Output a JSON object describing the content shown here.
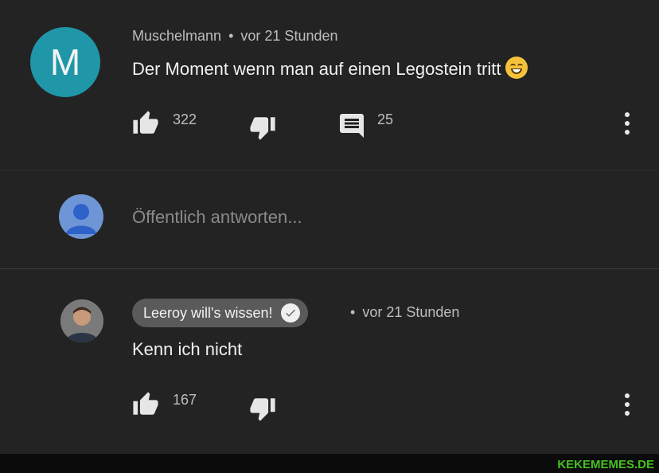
{
  "comment": {
    "avatar_letter": "M",
    "author": "Muschelmann",
    "separator": "•",
    "time": "vor 21 Stunden",
    "text": "Der Moment wenn man auf einen Legostein tritt",
    "likes": "322",
    "replies": "25"
  },
  "reply_box": {
    "placeholder": "Öffentlich antworten..."
  },
  "reply": {
    "author": "Leeroy will's wissen!",
    "separator": "•",
    "time": "vor 21 Stunden",
    "text": "Kenn ich nicht",
    "likes": "167"
  },
  "watermark": "KEKEMEMES.DE",
  "colors": {
    "background": "#232323",
    "avatar_teal": "#1f97a8",
    "default_avatar_blue": "#6e95d6",
    "watermark_green": "#43c21f"
  },
  "icons": [
    "thumb-up-icon",
    "thumb-down-icon",
    "comment-icon",
    "more-vert-icon",
    "verified-check-icon",
    "default-user-icon"
  ]
}
